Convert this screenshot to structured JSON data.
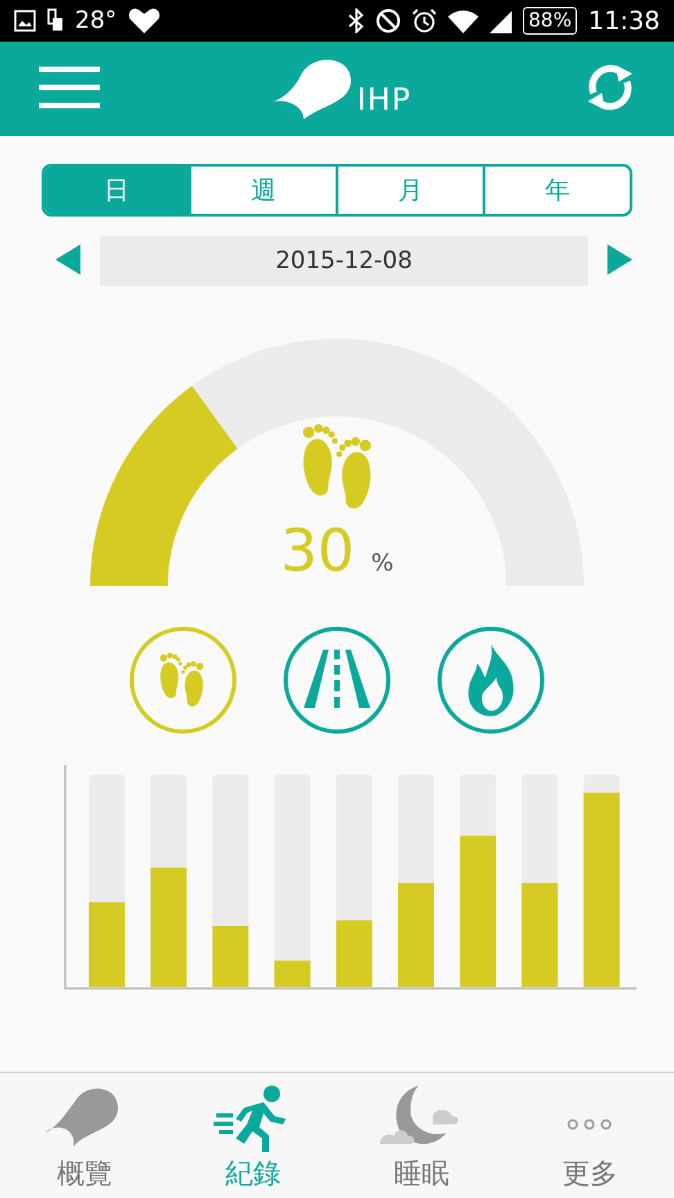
{
  "status_bar": {
    "temperature": "28°",
    "battery": "88%",
    "time": "11:38"
  },
  "app_bar": {
    "logo_text": "IHP"
  },
  "period_tabs": [
    {
      "label": "日",
      "selected": true
    },
    {
      "label": "週",
      "selected": false
    },
    {
      "label": "月",
      "selected": false
    },
    {
      "label": "年",
      "selected": false
    }
  ],
  "date_picker": {
    "value": "2015-12-08"
  },
  "gauge": {
    "value": "30",
    "unit": "%"
  },
  "modes": [
    {
      "kind": "steps",
      "selected": true
    },
    {
      "kind": "distance",
      "selected": false
    },
    {
      "kind": "calories",
      "selected": false
    }
  ],
  "bottom_nav": [
    {
      "kind": "overview",
      "label": "概覽",
      "selected": false
    },
    {
      "kind": "record",
      "label": "紀錄",
      "selected": true
    },
    {
      "kind": "sleep",
      "label": "睡眠",
      "selected": false
    },
    {
      "kind": "more",
      "label": "更多",
      "selected": false
    }
  ]
}
